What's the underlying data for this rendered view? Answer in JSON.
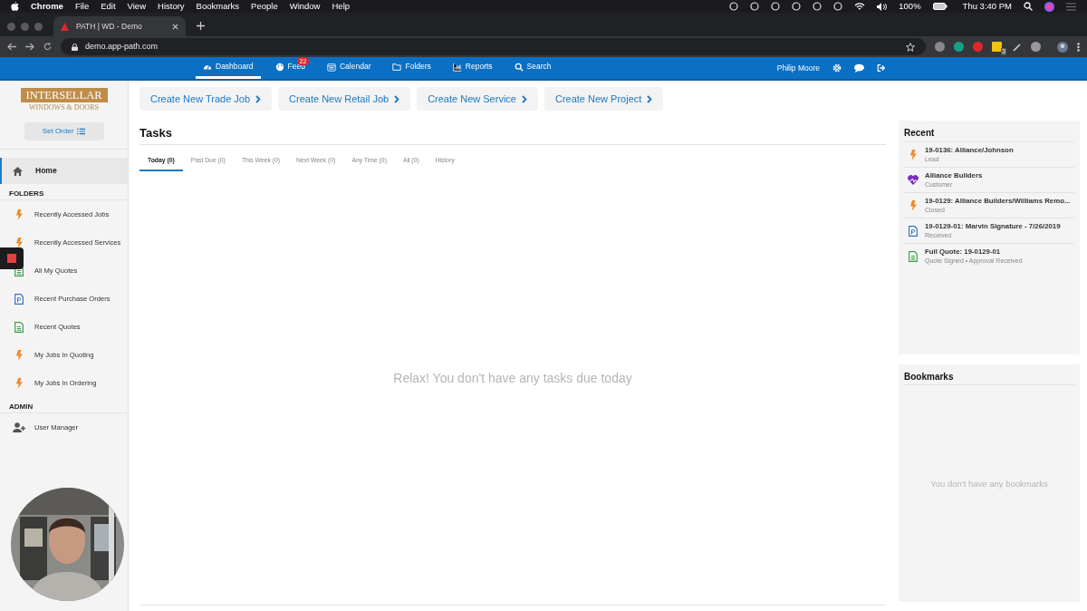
{
  "menu_bar": {
    "app": "Chrome",
    "items": [
      "File",
      "Edit",
      "View",
      "History",
      "Bookmarks",
      "People",
      "Window",
      "Help"
    ],
    "battery": "100%",
    "clock": "Thu 3:40 PM"
  },
  "browser": {
    "tab_title": "PATH | WD - Demo",
    "url": "demo.app-path.com",
    "extension_badge": "3"
  },
  "nav": {
    "items": [
      {
        "label": "Dashboard",
        "kind": "dashboard",
        "selected": true
      },
      {
        "label": "Feed",
        "kind": "feed",
        "selected": false,
        "badge": "22"
      },
      {
        "label": "Calendar",
        "kind": "calendar",
        "selected": false
      },
      {
        "label": "Folders",
        "kind": "folders",
        "selected": false
      },
      {
        "label": "Reports",
        "kind": "reports",
        "selected": false
      },
      {
        "label": "Search",
        "kind": "search",
        "selected": false
      }
    ],
    "user": "Philip Moore"
  },
  "sidebar": {
    "logo_top": "INTERSELLAR",
    "logo_bottom": "WINDOWS & DOORS",
    "set_order": "Set Order",
    "home": {
      "label": "Home",
      "selected": true
    },
    "sections": [
      {
        "title": "FOLDERS",
        "items": [
          {
            "label": "Recently Accessed Jobs",
            "kind": "job"
          },
          {
            "label": "Recently Accessed Services",
            "kind": "job"
          },
          {
            "label": "All My Quotes",
            "kind": "quote"
          },
          {
            "label": "Recent Purchase Orders",
            "kind": "po"
          },
          {
            "label": "Recent Quotes",
            "kind": "quote"
          },
          {
            "label": "My Jobs In Quoting",
            "kind": "job"
          },
          {
            "label": "My Jobs In Ordering",
            "kind": "job"
          }
        ]
      },
      {
        "title": "ADMIN",
        "items": [
          {
            "label": "User Manager",
            "kind": "user"
          }
        ]
      }
    ]
  },
  "actions": [
    "Create New Trade Job",
    "Create New Retail Job",
    "Create New Service",
    "Create New Project"
  ],
  "tasks": {
    "title": "Tasks",
    "tabs": [
      {
        "label": "Today (0)",
        "selected": true
      },
      {
        "label": "Past Due (0)",
        "selected": false
      },
      {
        "label": "This Week (0)",
        "selected": false
      },
      {
        "label": "Next Week (0)",
        "selected": false
      },
      {
        "label": "Any Time (0)",
        "selected": false
      },
      {
        "label": "All (0)",
        "selected": false
      },
      {
        "label": "History",
        "selected": false
      }
    ],
    "empty_message": "Relax! You don't have any tasks due today"
  },
  "recent": {
    "title": "Recent",
    "items": [
      {
        "title": "19-0136: Alliance/Johnson",
        "subtitle": "Lead",
        "kind": "job"
      },
      {
        "title": "Alliance Builders",
        "subtitle": "Customer",
        "kind": "customer"
      },
      {
        "title": "19-0129: Alliance Builders/Williams Remo...",
        "subtitle": "Closed",
        "kind": "job"
      },
      {
        "title": "19-0129-01: Marvin Signature - 7/26/2019",
        "subtitle": "Received",
        "kind": "po"
      },
      {
        "title": "Full Quote: 19-0129-01",
        "subtitle": "Quote Signed • Approval Received",
        "kind": "quote"
      }
    ]
  },
  "bookmarks": {
    "title": "Bookmarks",
    "empty_message": "You don't have any bookmarks"
  },
  "overlay": {
    "webcam": {
      "kind": "picture"
    }
  }
}
